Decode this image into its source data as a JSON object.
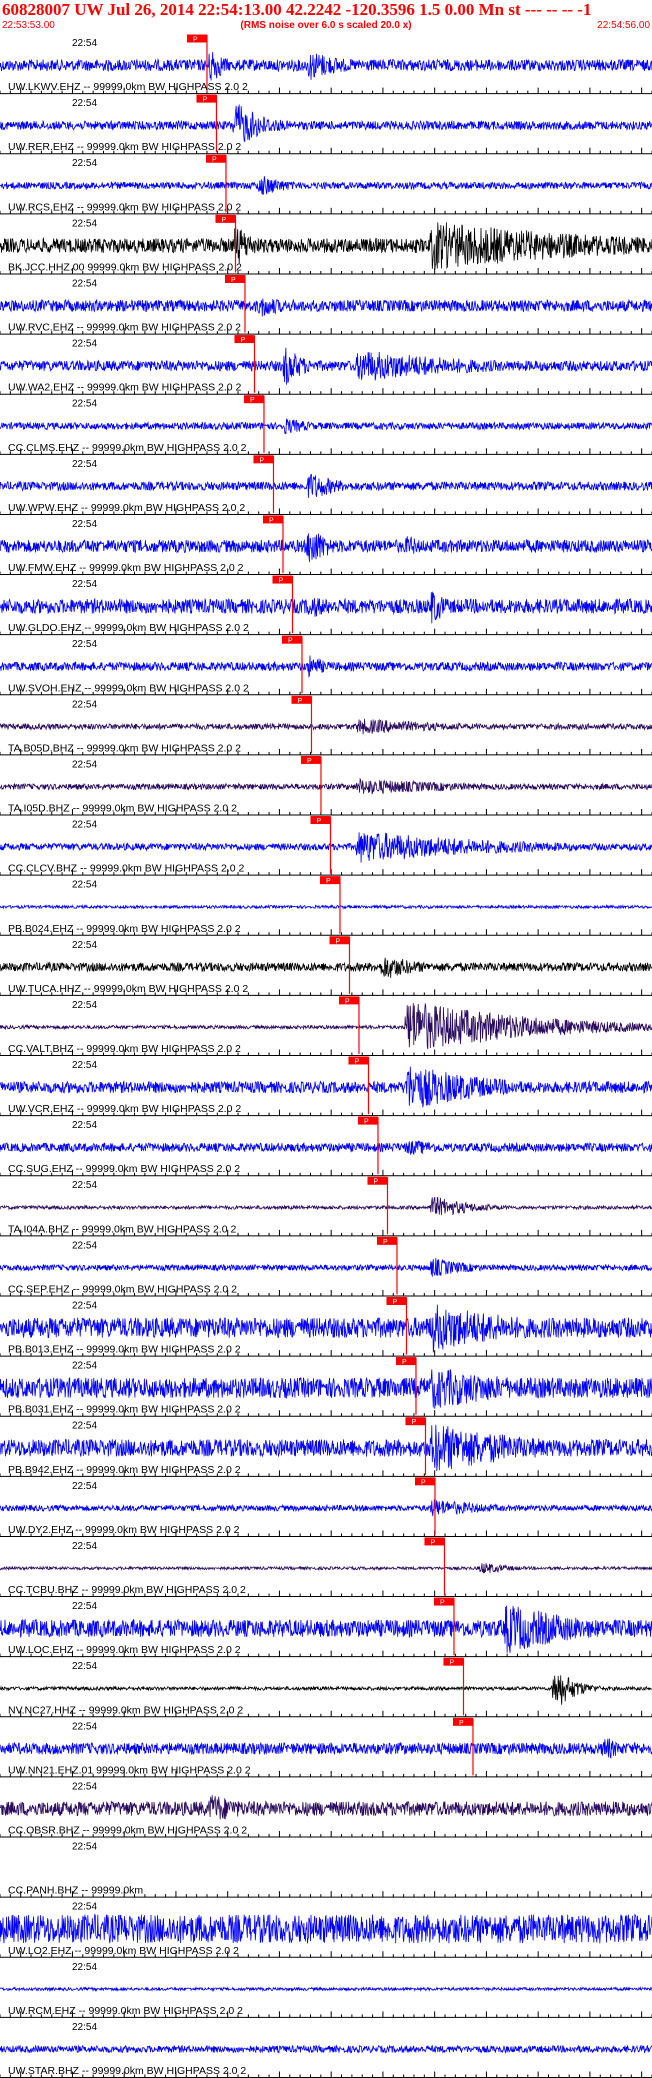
{
  "header": {
    "title": "60828007 UW Jul 26, 2014 22:54:13.00   42.2242 -120.3596  1.5 0.00 Mn st --- -- --   -1",
    "start_time": "22:53:53.00",
    "subtitle": "(RMS noise over 6.0 s scaled 20.0 x)",
    "end_time": "22:54:56.00"
  },
  "colors": {
    "blue": "#0000ff",
    "black": "#000000",
    "purple": "#2a0a5e",
    "pick": "#ff0000",
    "header": "#ff0000"
  },
  "chart_data": {
    "type": "seismogram",
    "time_range": [
      "22:53:53.00",
      "22:54:56.00"
    ],
    "time_axis_label": "22:54",
    "pick_label": "P",
    "traces": [
      {
        "label": "UW.LKWV.EHZ -- 99999.0km BW  HIGHPASS  2.0  2",
        "color": "blue",
        "pick": 22.54,
        "noise": 0.2,
        "bursts": [
          [
            22.54,
            0.95,
            1.4
          ],
          [
            22.58,
            0.6,
            4
          ]
        ]
      },
      {
        "label": "UW.RER.EHZ -- 99999.0km BW  HIGHPASS  2.0  2",
        "color": "blue",
        "pick": 22.54,
        "noise": 0.15,
        "bursts": [
          [
            22.55,
            0.95,
            3
          ]
        ]
      },
      {
        "label": "UW.RCS.EHZ -- 99999.0km BW  HIGHPASS  2.0  2",
        "color": "blue",
        "pick": 22.54,
        "noise": 0.12,
        "bursts": [
          [
            22.56,
            0.45,
            3
          ]
        ]
      },
      {
        "label": "BK.JCC.HHZ.00 99999.0km BW  HIGHPASS  2.0  2",
        "color": "black",
        "pick": 22.54,
        "noise": 0.25,
        "bursts": [
          [
            22.55,
            0.95,
            2
          ],
          [
            22.63,
            0.9,
            18
          ]
        ]
      },
      {
        "label": "UW.RVC.EHZ -- 99999.0km BW  HIGHPASS  2.0  2",
        "color": "blue",
        "pick": 22.54,
        "noise": 0.2,
        "bursts": [
          [
            22.56,
            0.5,
            3
          ]
        ]
      },
      {
        "label": "UW.WA2.EHZ -- 99999.0km BW  HIGHPASS  2.0  2",
        "color": "blue",
        "pick": 22.54,
        "noise": 0.18,
        "bursts": [
          [
            22.57,
            0.9,
            2
          ],
          [
            22.6,
            0.6,
            12
          ]
        ]
      },
      {
        "label": "CC.CLMS.EHZ -- 99999.0km BW  HIGHPASS  2.0  2",
        "color": "blue",
        "pick": 22.54,
        "noise": 0.12,
        "bursts": [
          [
            22.57,
            0.35,
            3
          ]
        ]
      },
      {
        "label": "UW.WPW.EHZ -- 99999.0km BW  HIGHPASS  2.0  2",
        "color": "blue",
        "pick": 22.54,
        "noise": 0.15,
        "bursts": [
          [
            22.58,
            0.6,
            3
          ]
        ]
      },
      {
        "label": "UW.FMW.EHZ -- 99999.0km BW  HIGHPASS  2.0  2",
        "color": "blue",
        "pick": 22.54,
        "noise": 0.22,
        "bursts": [
          [
            22.58,
            0.95,
            2
          ],
          [
            22.62,
            0.55,
            1.5
          ]
        ]
      },
      {
        "label": "UW.GLDO.EHZ -- 99999.0km BW  HIGHPASS  2.0  2",
        "color": "blue",
        "pick": 22.54,
        "noise": 0.25,
        "bursts": [
          [
            22.58,
            0.5,
            3
          ],
          [
            22.63,
            0.9,
            1.5
          ]
        ]
      },
      {
        "label": "UW.SVOH.EHZ -- 99999.0km BW  HIGHPASS  2.0  2",
        "color": "blue",
        "pick": 22.54,
        "noise": 0.15,
        "bursts": [
          [
            22.58,
            0.5,
            2
          ]
        ]
      },
      {
        "label": "TA.B05D.BHZ -- 99999.0km BW  HIGHPASS  2.0  2",
        "color": "purple",
        "pick": 22.54,
        "noise": 0.1,
        "bursts": [
          [
            22.6,
            0.3,
            10
          ]
        ]
      },
      {
        "label": "TA.I05D.BHZ -- 99999.0km BW  HIGHPASS  2.0  2",
        "color": "purple",
        "pick": 22.54,
        "noise": 0.1,
        "bursts": [
          [
            22.6,
            0.3,
            12
          ]
        ]
      },
      {
        "label": "CC.CLCV.BHZ -- 99999.0km BW  HIGHPASS  2.0  2",
        "color": "blue",
        "pick": 22.54,
        "noise": 0.12,
        "bursts": [
          [
            22.6,
            0.6,
            14
          ]
        ]
      },
      {
        "label": "PB.B024.EHZ -- 99999.0km BW  HIGHPASS  2.0  2",
        "color": "blue",
        "pick": 22.54,
        "noise": 0.05,
        "bursts": []
      },
      {
        "label": "UW.TUCA.HHZ -- 99999.0km BW  HIGHPASS  2.0  2",
        "color": "black",
        "pick": 22.54,
        "noise": 0.15,
        "bursts": [
          [
            22.61,
            0.5,
            4
          ]
        ]
      },
      {
        "label": "CC.VALT.BHZ -- 99999.0km BW  HIGHPASS  2.0  2",
        "color": "purple",
        "pick": 22.54,
        "noise": 0.06,
        "bursts": [
          [
            22.62,
            1.0,
            12
          ]
        ]
      },
      {
        "label": "UW.VCR.EHZ -- 99999.0km BW  HIGHPASS  2.0  2",
        "color": "blue",
        "pick": 22.54,
        "noise": 0.2,
        "bursts": [
          [
            22.62,
            0.9,
            8
          ]
        ]
      },
      {
        "label": "CC.SUG.EHZ -- 99999.0km BW  HIGHPASS  2.0  2",
        "color": "blue",
        "pick": 22.54,
        "noise": 0.15,
        "bursts": [
          [
            22.62,
            0.3,
            6
          ]
        ]
      },
      {
        "label": "TA.I04A.BHZ -- 99999.0km BW  HIGHPASS  2.0  2",
        "color": "purple",
        "pick": 22.54,
        "noise": 0.06,
        "bursts": [
          [
            22.63,
            0.45,
            4
          ]
        ]
      },
      {
        "label": "CC.SEP.EHZ -- 99999.0km BW  HIGHPASS  2.0  2",
        "color": "blue",
        "pick": 22.54,
        "noise": 0.1,
        "bursts": [
          [
            22.63,
            0.4,
            4
          ]
        ]
      },
      {
        "label": "PB.B013.EHZ -- 99999.0km BW  HIGHPASS  2.0  2",
        "color": "blue",
        "pick": 22.54,
        "noise": 0.35,
        "bursts": [
          [
            22.63,
            0.9,
            10
          ]
        ]
      },
      {
        "label": "PB.B031.EHZ -- 99999.0km BW  HIGHPASS  2.0  2",
        "color": "blue",
        "pick": 22.54,
        "noise": 0.35,
        "bursts": [
          [
            22.63,
            0.8,
            10
          ]
        ]
      },
      {
        "label": "PB.B942.EHZ -- 99999.0km BW  HIGHPASS  2.0  2",
        "color": "blue",
        "pick": 22.54,
        "noise": 0.3,
        "bursts": [
          [
            22.63,
            0.95,
            10
          ]
        ]
      },
      {
        "label": "UW.DY2.EHZ -- 99999.0km BW  HIGHPASS  2.0  2",
        "color": "blue",
        "pick": 22.54,
        "noise": 0.1,
        "bursts": [
          [
            22.63,
            0.35,
            6
          ]
        ]
      },
      {
        "label": "CC.TCBU.BHZ -- 99999.0km BW  HIGHPASS  2.0  2",
        "color": "purple",
        "pick": 22.54,
        "noise": 0.05,
        "bursts": [
          [
            22.65,
            0.25,
            3
          ]
        ]
      },
      {
        "label": "UW.LOC.EHZ -- 99999.0km BW  HIGHPASS  2.0  2",
        "color": "blue",
        "pick": 22.54,
        "noise": 0.3,
        "bursts": [
          [
            22.66,
            0.95,
            8
          ]
        ]
      },
      {
        "label": "NV.NC27.HHZ -- 99999.0km BW  HIGHPASS  2.0  2",
        "color": "black",
        "pick": 22.54,
        "noise": 0.06,
        "bursts": [
          [
            22.68,
            0.95,
            2
          ]
        ]
      },
      {
        "label": "UW.NN21.EHZ.01 99999.0km BW  HIGHPASS  2.0  2",
        "color": "blue",
        "pick": 22.54,
        "noise": 0.2,
        "bursts": [
          [
            22.7,
            0.55,
            2
          ]
        ]
      },
      {
        "label": "CC.OBSR.BHZ -- 99999.0km BW  HIGHPASS  2.0  2",
        "color": "purple",
        "pick": null,
        "noise": 0.25,
        "bursts": [
          [
            22.54,
            0.6,
            4
          ]
        ]
      },
      {
        "label": "CC.PANH.BHZ -- 99999.0km",
        "color": "blue",
        "pick": null,
        "noise": 0.0,
        "bursts": []
      },
      {
        "label": "UW.LO2.EHZ -- 99999.0km BW  HIGHPASS  2.0  2",
        "color": "blue",
        "pick": null,
        "noise": 0.5,
        "bursts": []
      },
      {
        "label": "UW.RCM.EHZ -- 99999.0km BW  HIGHPASS  2.0  2",
        "color": "blue",
        "pick": null,
        "noise": 0.05,
        "bursts": []
      },
      {
        "label": "UW.STAR.BHZ -- 99999.0km BW  HIGHPASS  2.0  2",
        "color": "blue",
        "pick": null,
        "noise": 0.12,
        "bursts": []
      }
    ]
  }
}
